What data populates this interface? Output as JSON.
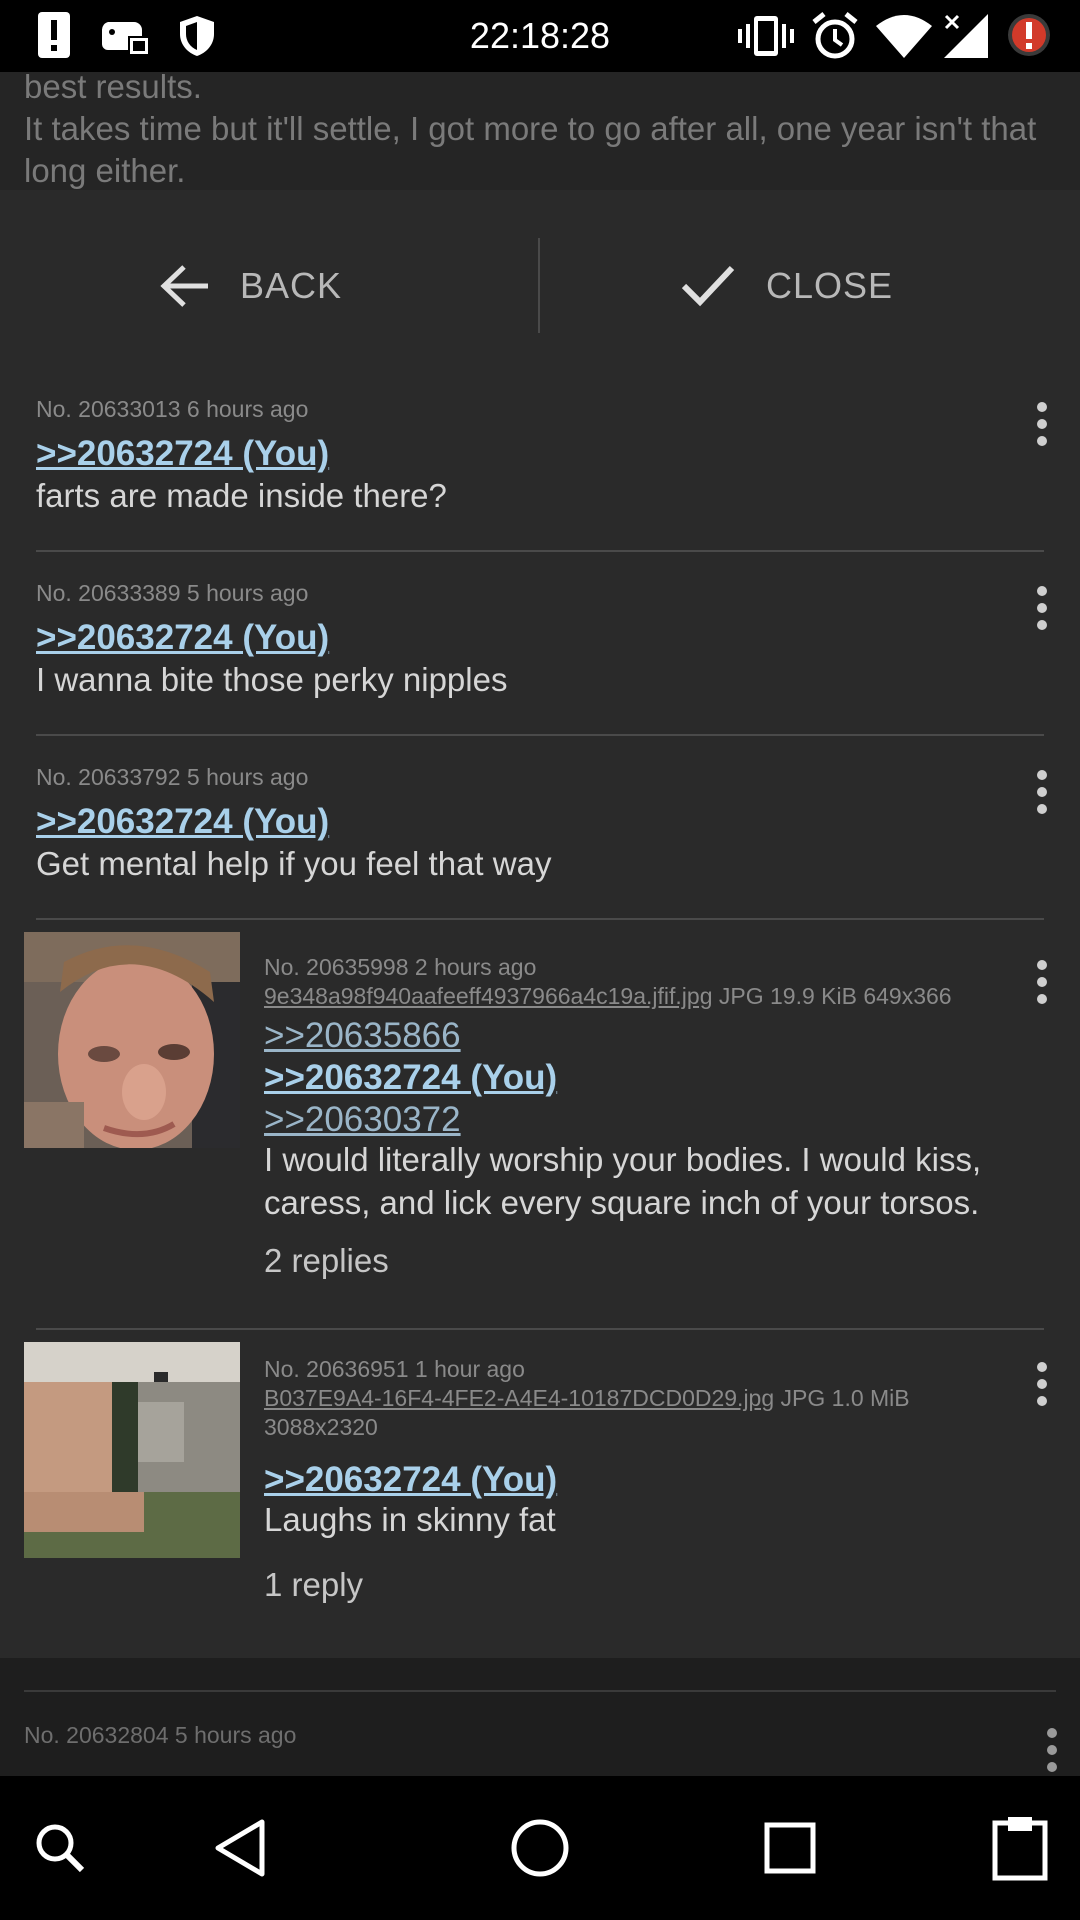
{
  "status_bar": {
    "time": "22:18:28"
  },
  "background_post": {
    "line1": "best results.",
    "line2": "It takes time but it'll settle, I got more to go after all, one year isn't that long either."
  },
  "toolbar": {
    "back_label": "BACK",
    "close_label": "CLOSE"
  },
  "posts": [
    {
      "meta": "No. 20633013 6 hours ago",
      "quotes": [
        ">>20632724 (You)"
      ],
      "body": "farts are made inside there?"
    },
    {
      "meta": "No. 20633389 5 hours ago",
      "quotes": [
        ">>20632724 (You)"
      ],
      "body": "I wanna bite those perky nipples"
    },
    {
      "meta": "No. 20633792 5 hours ago",
      "quotes": [
        ">>20632724 (You)"
      ],
      "body": "Get mental help if you feel that way"
    },
    {
      "meta": "No. 20635998 2 hours ago",
      "file_name": "9e348a98f940aafeeff4937966a4c19a.jfif.jpg",
      "file_info": " JPG 19.9 KiB 649x366",
      "quotes": [
        ">>20635866",
        ">>20632724 (You)",
        ">>20630372"
      ],
      "body": "I would literally worship your bodies. I would kiss, caress, and lick every square inch of your torsos.",
      "replies": "2 replies"
    },
    {
      "meta": "No. 20636951 1 hour ago",
      "file_name": "B037E9A4-16F4-4FE2-A4E4-10187DCD0D29.jpg",
      "file_info": " JPG 1.0 MiB",
      "file_dims": "3088x2320",
      "quotes": [
        ">>20632724 (You)"
      ],
      "body": "Laughs in skinny fat",
      "replies": "1 reply"
    }
  ],
  "below_post": {
    "meta": "No. 20632804 5 hours ago"
  },
  "icons": {
    "status_left": [
      "alert-icon",
      "gamepad-icon",
      "shield-icon"
    ],
    "status_right": [
      "vibrate-icon",
      "alarm-icon",
      "wifi-icon",
      "signal-icon",
      "error-badge-icon"
    ],
    "nav": [
      "search-icon",
      "back-triangle-icon",
      "home-circle-icon",
      "recents-square-icon",
      "clipboard-icon"
    ]
  },
  "colors": {
    "quote_link": "#a9d0ea",
    "error_badge": "#d23a2a"
  }
}
